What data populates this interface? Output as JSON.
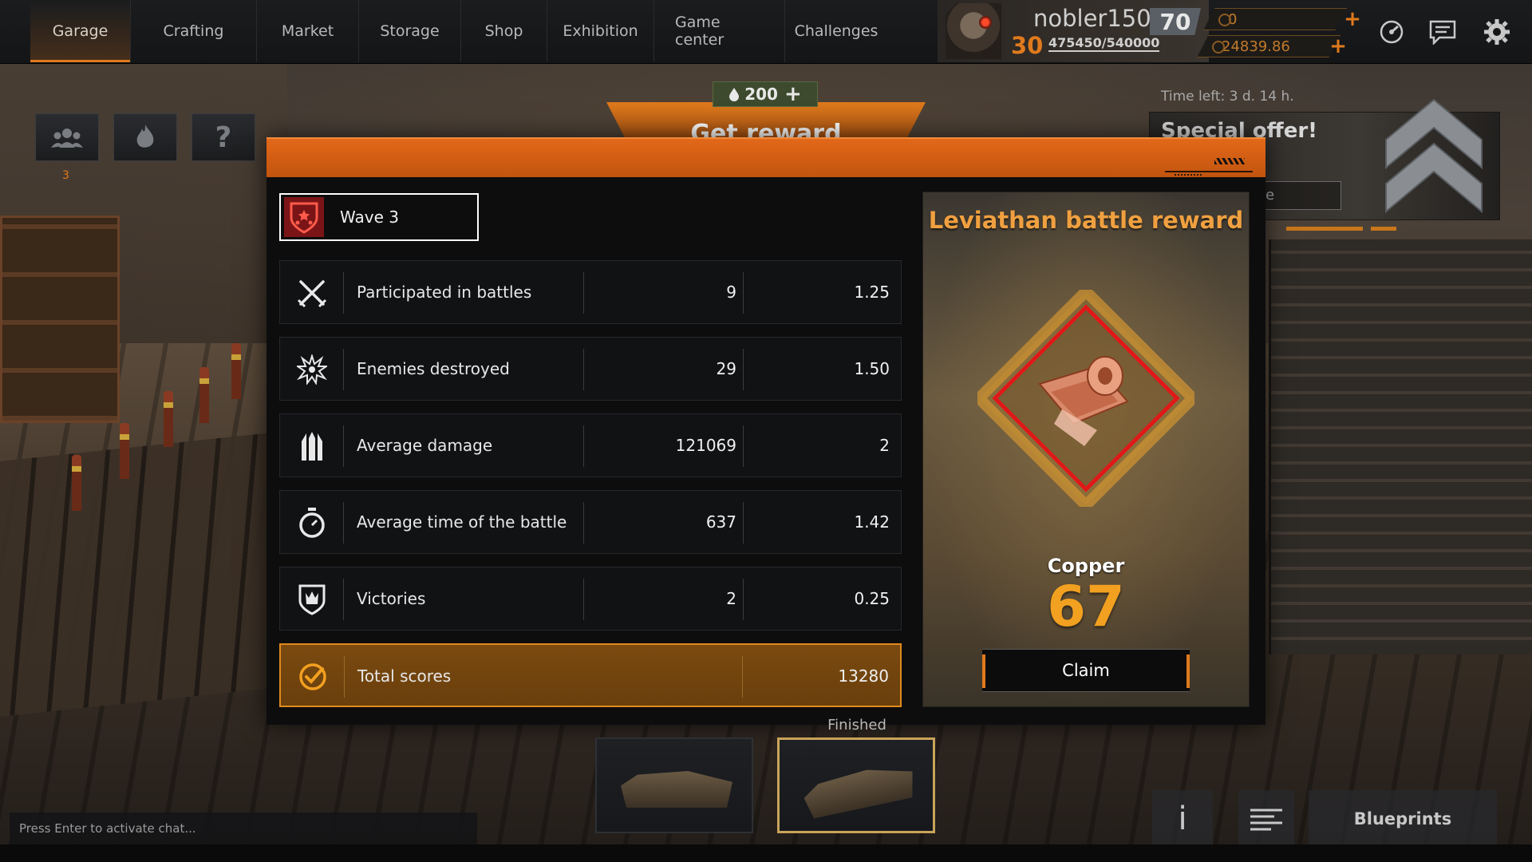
{
  "nav": {
    "items": [
      {
        "label": "Garage",
        "active": true
      },
      {
        "label": "Crafting",
        "active": false
      },
      {
        "label": "Market",
        "active": false
      },
      {
        "label": "Storage",
        "active": false
      },
      {
        "label": "Shop",
        "active": false
      },
      {
        "label": "Exhibition",
        "active": false
      },
      {
        "label": "Game center",
        "active": false
      },
      {
        "label": "Challenges",
        "active": false
      }
    ]
  },
  "profile": {
    "username": "nobler1500",
    "level": "70",
    "rank": "30",
    "xp": "475450/540000"
  },
  "currencies": [
    {
      "value": "0",
      "icon": "coin-icon"
    },
    {
      "value": "24839.86",
      "icon": "coin-icon"
    }
  ],
  "side_buttons": {
    "group_count": "3",
    "help_label": "?"
  },
  "reward_banner": {
    "cost": "200",
    "cost_plus": "+",
    "label": "Get reward"
  },
  "special_offer": {
    "time_left": "Time left: 3 d. 14 h.",
    "title": "Special offer!",
    "button_fragment": "e"
  },
  "modal": {
    "wave_label": "Wave 3",
    "stats": [
      {
        "icon": "crossed-swords-icon",
        "label": "Participated in battles",
        "value": "9",
        "multiplier": "1.25"
      },
      {
        "icon": "explosion-icon",
        "label": "Enemies destroyed",
        "value": "29",
        "multiplier": "1.50"
      },
      {
        "icon": "damage-icon",
        "label": "Average damage",
        "value": "121069",
        "multiplier": "2"
      },
      {
        "icon": "stopwatch-icon",
        "label": "Average time of the battle",
        "value": "637",
        "multiplier": "1.42"
      },
      {
        "icon": "shield-icon",
        "label": "Victories",
        "value": "2",
        "multiplier": "0.25"
      }
    ],
    "total": {
      "icon": "checkmark-icon",
      "label": "Total scores",
      "value": "13280"
    }
  },
  "reward": {
    "title": "Leviathan battle reward",
    "item_name": "Copper",
    "item_count": "67",
    "claim_label": "Claim"
  },
  "bottom": {
    "finished_label": "Finished",
    "chat_placeholder": "Press Enter to activate chat...",
    "info_label": "i",
    "blueprints_label": "Blueprints"
  },
  "colors": {
    "accent": "#e07a1c",
    "reward_title": "#f0a040",
    "item_count": "#f2a020",
    "diamond_border": "#e01818",
    "total_row": "#7a4a10"
  }
}
